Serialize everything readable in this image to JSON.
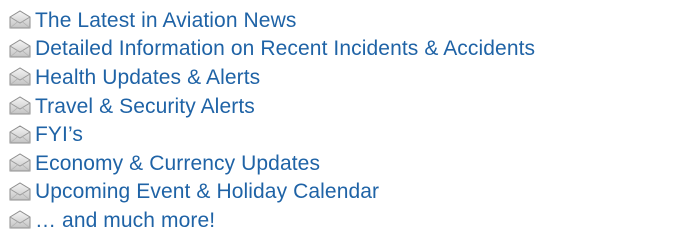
{
  "icon": "envelope-icon",
  "colors": {
    "text": "#1f63a6",
    "icon_light": "#f2f2f2",
    "icon_mid": "#c9c9c9",
    "icon_dark": "#8e8e8e"
  },
  "items": [
    {
      "label": "The Latest in Aviation News"
    },
    {
      "label": "Detailed Information on Recent Incidents & Accidents"
    },
    {
      "label": "Health Updates & Alerts"
    },
    {
      "label": "Travel & Security Alerts"
    },
    {
      "label": "FYI’s"
    },
    {
      "label": "Economy & Currency Updates"
    },
    {
      "label": "Upcoming Event & Holiday Calendar"
    },
    {
      "label": "… and much more!"
    }
  ]
}
